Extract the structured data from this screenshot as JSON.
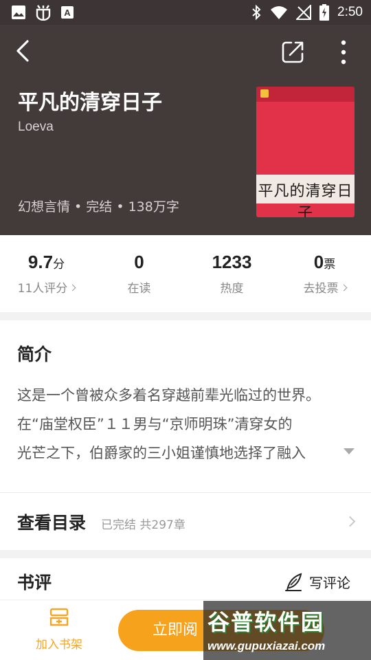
{
  "status_bar": {
    "time": "2:50",
    "icons": [
      "image-icon",
      "bug-icon",
      "font-icon",
      "bluetooth-icon",
      "wifi-icon",
      "no-signal-icon",
      "battery-charging-icon"
    ]
  },
  "header": {
    "back_icon": "back-icon",
    "share_icon": "share-icon",
    "more_icon": "more-vertical-icon"
  },
  "book": {
    "title": "平凡的清穿日子",
    "author": "Loeva",
    "meta": "幻想言情 • 完结 • 138万字",
    "cover_title": "平凡的清穿日子",
    "cover_color": "#e1324a"
  },
  "stats": [
    {
      "value": "9.7",
      "unit": "分",
      "label": "11人评分",
      "has_chevron": true
    },
    {
      "value": "0",
      "unit": "",
      "label": "在读",
      "has_chevron": false
    },
    {
      "value": "1233",
      "unit": "",
      "label": "热度",
      "has_chevron": false
    },
    {
      "value": "0",
      "unit": "票",
      "label": "去投票",
      "has_chevron": true
    }
  ],
  "intro": {
    "heading": "简介",
    "lines": [
      "这是一个曾被众多着名穿越前辈光临过的世界。",
      "在“庙堂权臣”１１男与“京师明珠”清穿女的",
      "光芒之下，伯爵家的三小姐谨慎地选择了融入"
    ]
  },
  "catalog": {
    "title": "查看目录",
    "status": "已完结 共297章"
  },
  "reviews": {
    "title": "书评",
    "write_label": "写评论"
  },
  "bottom_bar": {
    "add_shelf_label": "加入书架",
    "read_label": "立即阅",
    "accent_color": "#f7a21c"
  },
  "watermark": {
    "main": "谷普软件园",
    "url": "www.gupuxiazai.com"
  }
}
